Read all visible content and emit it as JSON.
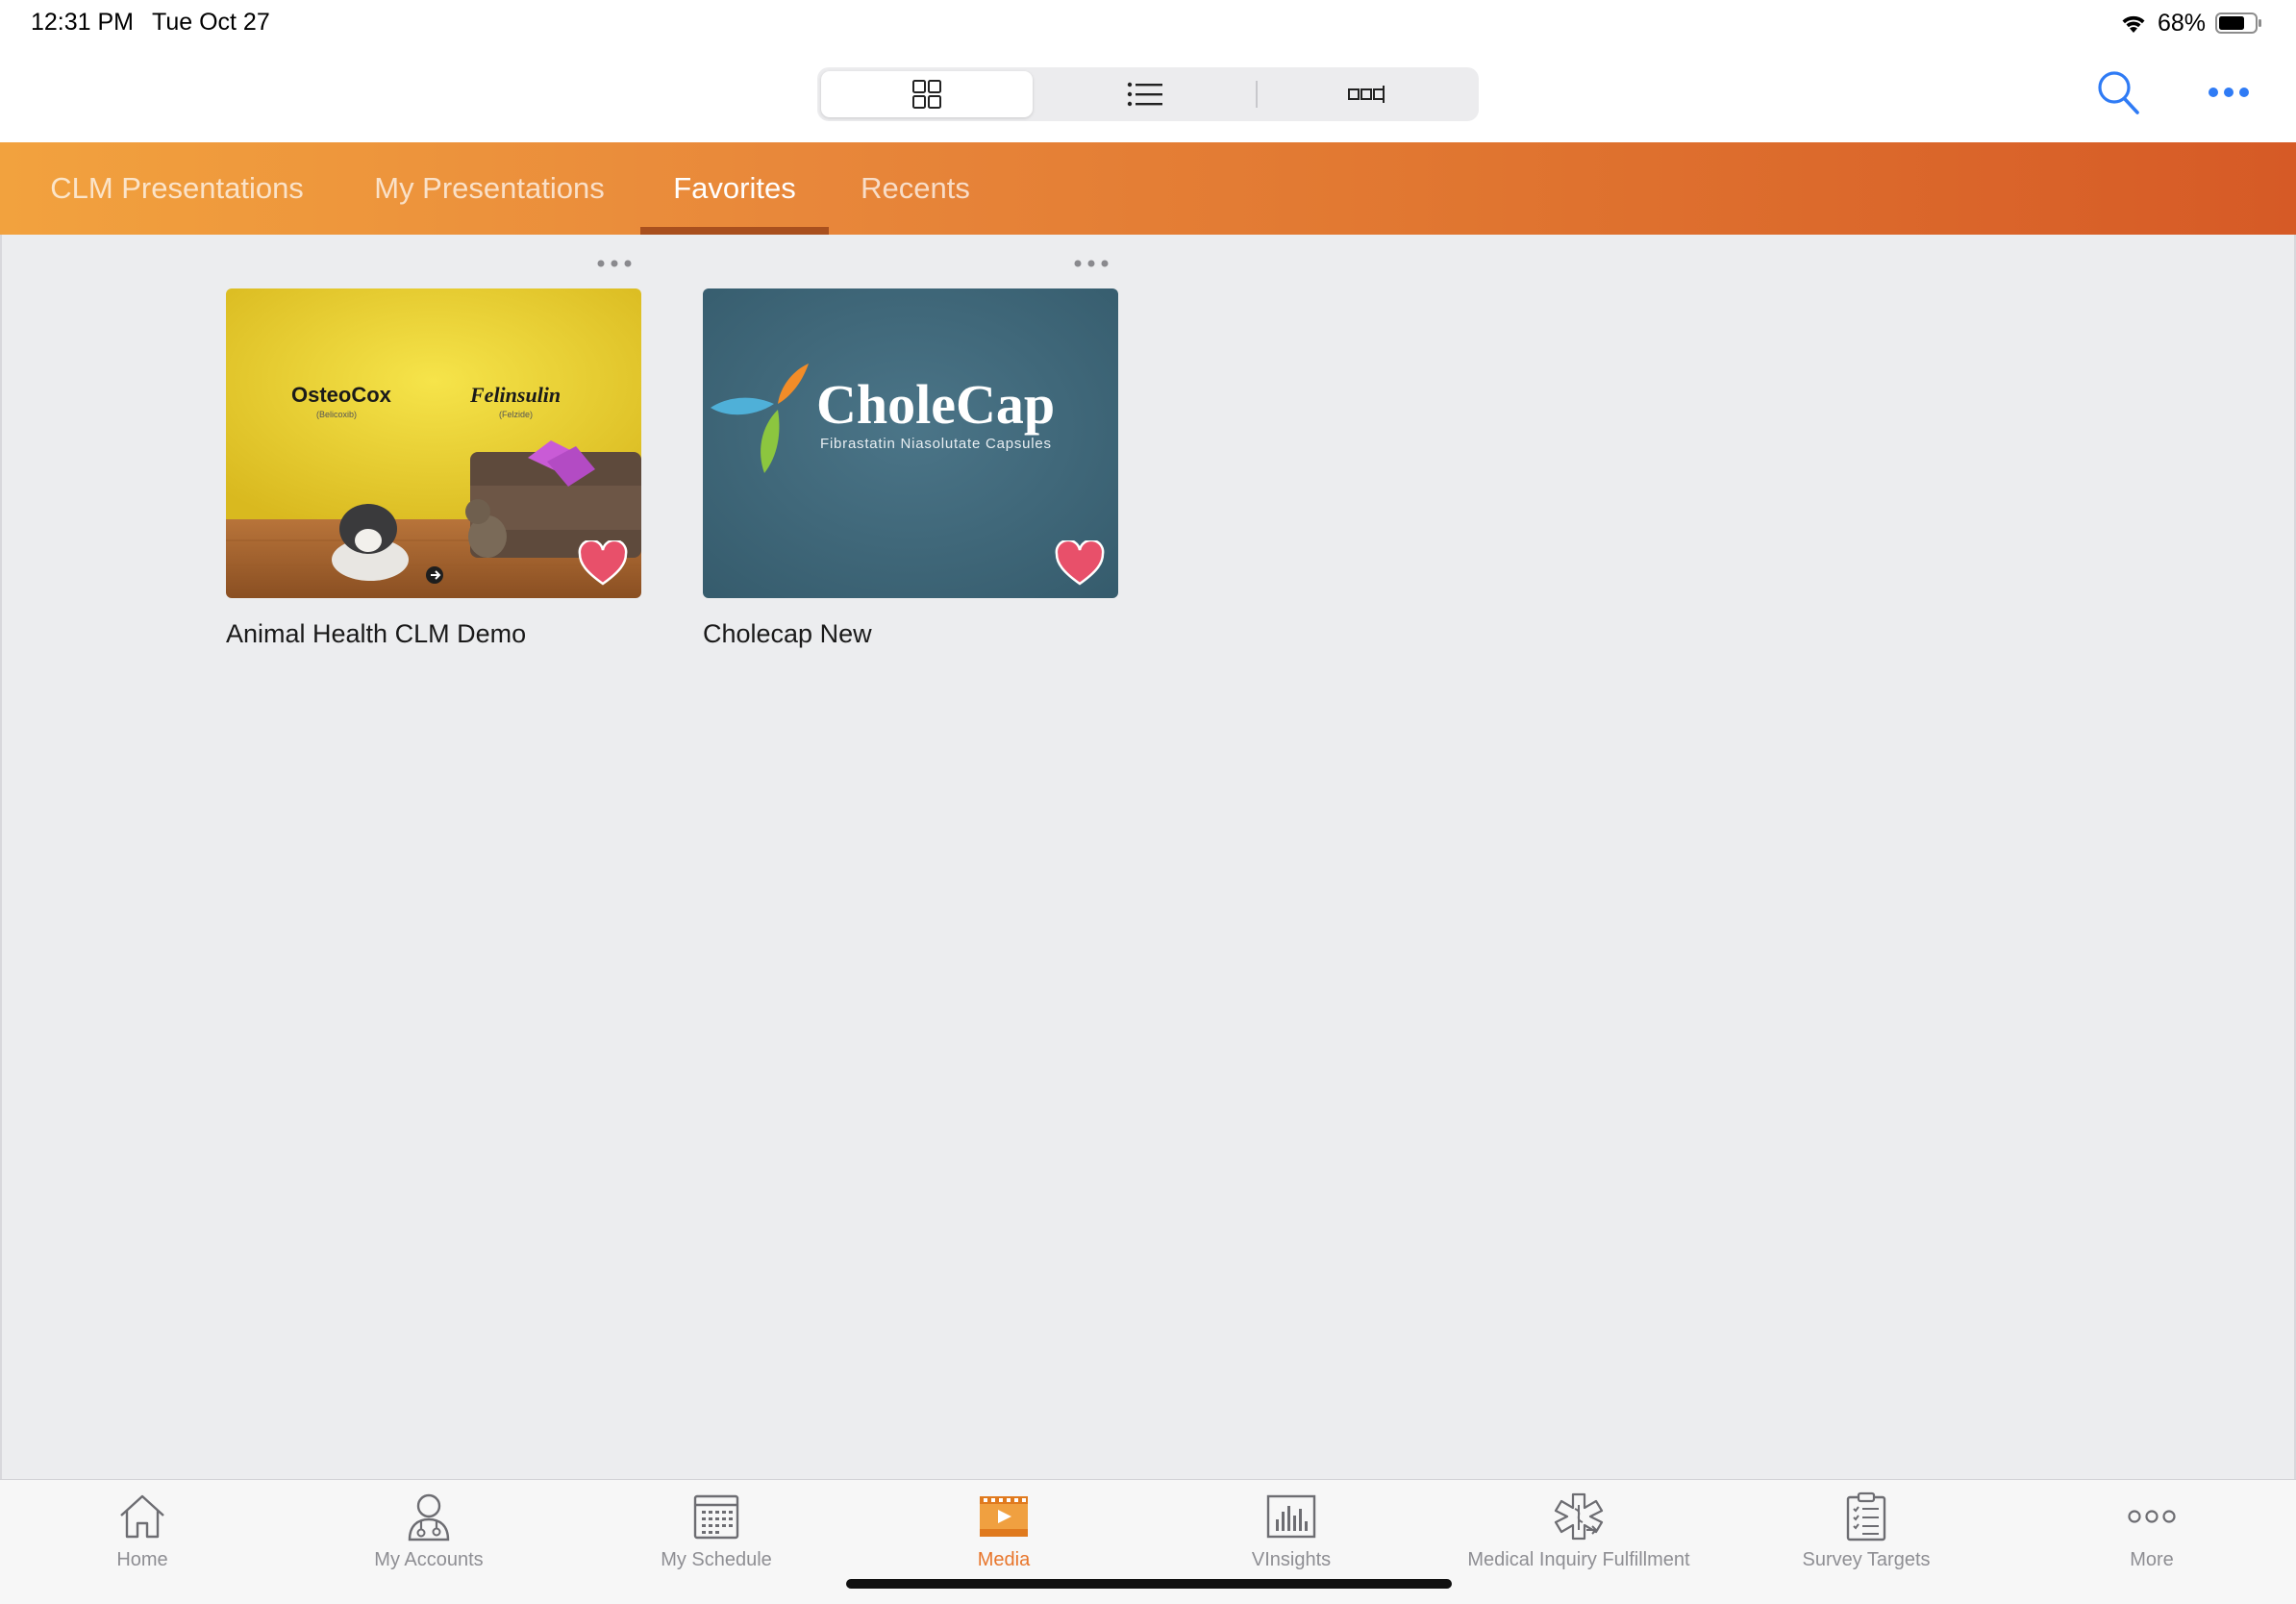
{
  "status_bar": {
    "time": "12:31 PM",
    "date": "Tue Oct 27",
    "battery_percent": "68%",
    "icons": [
      "wifi-icon",
      "battery-icon"
    ]
  },
  "top_nav": {
    "view_modes": [
      {
        "name": "grid-view",
        "icon": "grid-icon",
        "selected": true
      },
      {
        "name": "list-view",
        "icon": "list-icon",
        "selected": false
      },
      {
        "name": "carousel-view",
        "icon": "carousel-icon",
        "selected": false
      }
    ],
    "actions": [
      "search-icon",
      "more-horizontal-icon"
    ]
  },
  "tabs": [
    {
      "label": "CLM Presentations",
      "selected": false
    },
    {
      "label": "My Presentations",
      "selected": false
    },
    {
      "label": "Favorites",
      "selected": true
    },
    {
      "label": "Recents",
      "selected": false
    }
  ],
  "presentations": [
    {
      "title": "Animal Health CLM Demo",
      "favorite": true,
      "thumbnail": {
        "brand_left": "OsteoCox",
        "brand_left_sub": "(Belicoxib)",
        "brand_right": "Felinsulin",
        "brand_right_sub": "(Felzide)"
      }
    },
    {
      "title": "Cholecap New",
      "favorite": true,
      "thumbnail": {
        "brand": "CholeCap",
        "tagline": "Fibrastatin Niasolutate Capsules"
      }
    }
  ],
  "bottom_tabs": [
    {
      "label": "Home",
      "icon": "home-icon",
      "selected": false
    },
    {
      "label": "My Accounts",
      "icon": "accounts-icon",
      "selected": false
    },
    {
      "label": "My Schedule",
      "icon": "calendar-icon",
      "selected": false
    },
    {
      "label": "Media",
      "icon": "media-icon",
      "selected": true
    },
    {
      "label": "VInsights",
      "icon": "chart-icon",
      "selected": false
    },
    {
      "label": "Medical Inquiry Fulfillment",
      "icon": "medical-inquiry-icon",
      "selected": false
    },
    {
      "label": "Survey Targets",
      "icon": "clipboard-icon",
      "selected": false
    },
    {
      "label": "More",
      "icon": "more-icon",
      "selected": false
    }
  ],
  "colors": {
    "accent_orange": "#e8762c",
    "tab_bar_start": "#f2a23e",
    "tab_bar_end": "#d65a26",
    "ios_blue": "#2f7bf5",
    "heart": "#e8506a"
  }
}
